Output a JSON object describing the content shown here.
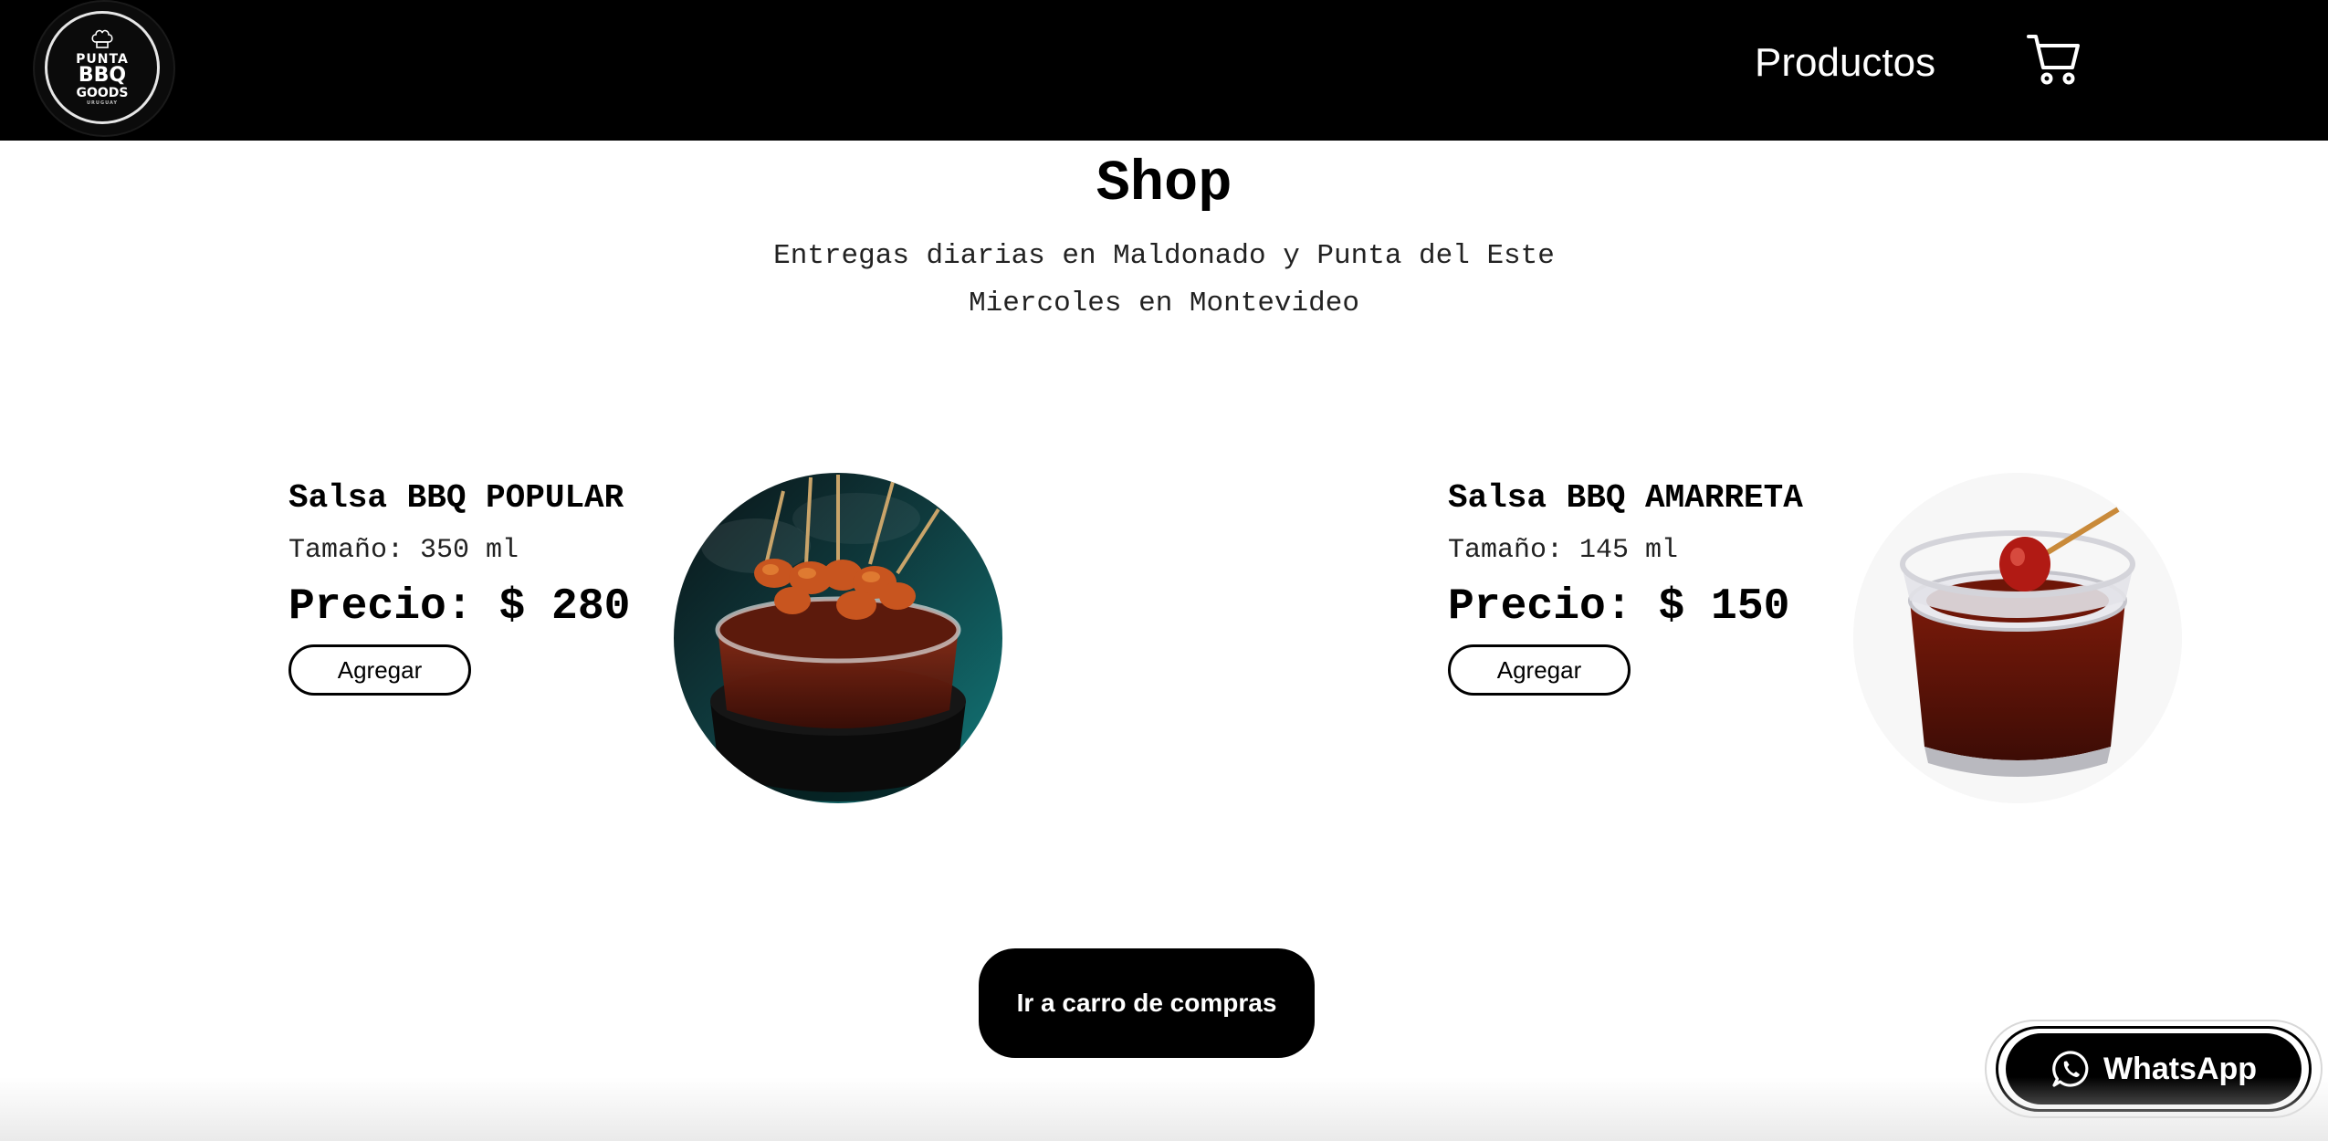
{
  "header": {
    "logo": {
      "lines": [
        "PUNTA",
        "BBQ",
        "GOODS",
        "URUGUAY"
      ],
      "icon": "chef-hat-icon"
    },
    "nav": [
      {
        "label": "Productos"
      }
    ],
    "cart_icon": "shopping-cart-icon"
  },
  "main": {
    "title": "Shop",
    "subtitle_line1": "Entregas diarias en Maldonado y Punta del Este",
    "subtitle_line2": "Miercoles en Montevideo",
    "products": [
      {
        "name": "Salsa BBQ POPULAR",
        "size": "Tamaño: 350 ml",
        "price": "Precio: $ 280",
        "add_label": "Agregar"
      },
      {
        "name": "Salsa BBQ AMARRETA",
        "size": "Tamaño: 145 ml",
        "price": "Precio: $ 150",
        "add_label": "Agregar"
      }
    ],
    "go_cart_label": "Ir a carro de compras"
  },
  "whatsapp": {
    "label": "WhatsApp",
    "icon": "whatsapp-icon"
  },
  "colors": {
    "header_bg": "#000000",
    "primary": "#000000",
    "background": "#ffffff"
  }
}
